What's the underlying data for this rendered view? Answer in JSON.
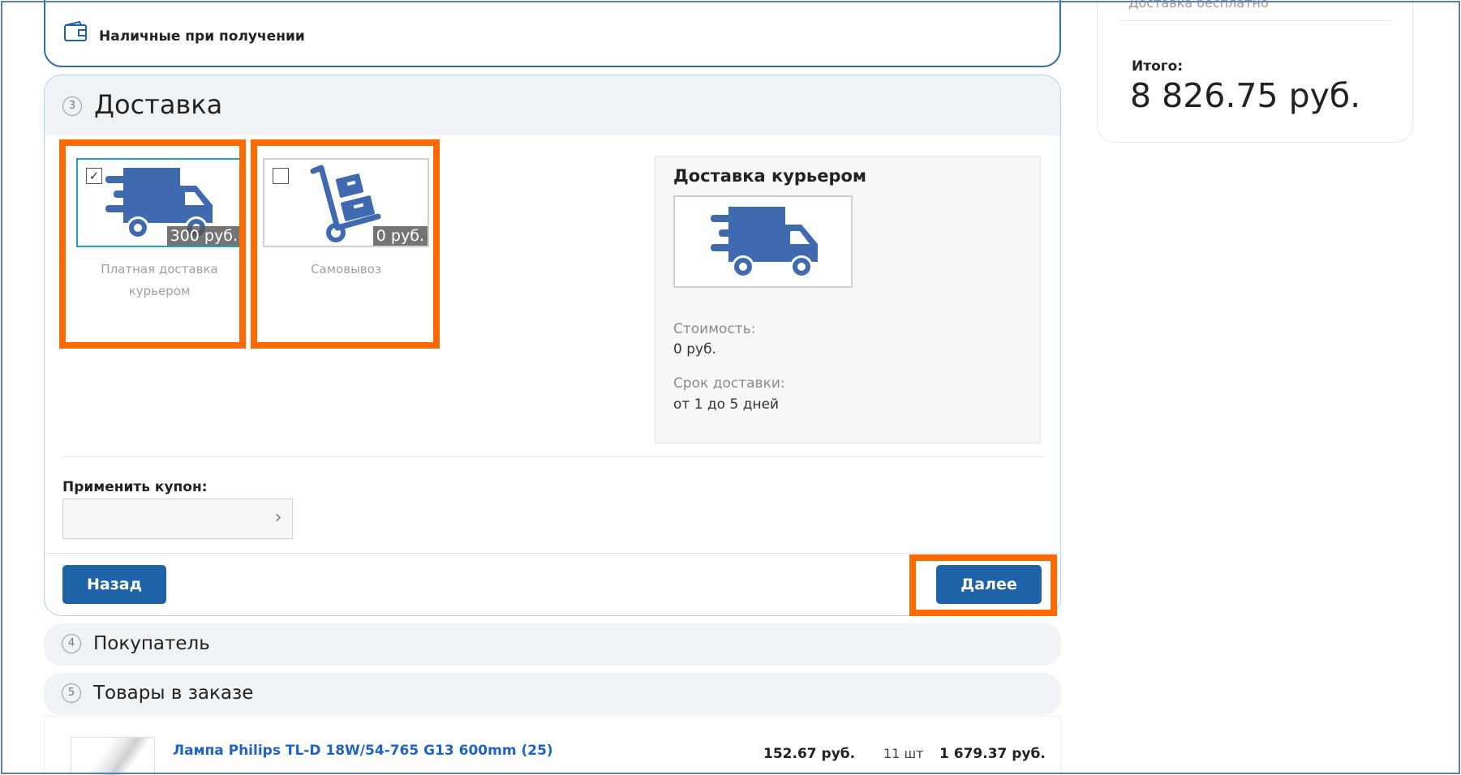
{
  "payment": {
    "selected_label": "Наличные при получении"
  },
  "delivery": {
    "step": "3",
    "title": "Доставка",
    "options": [
      {
        "price": "300 руб.",
        "label": "Платная доставка курьером",
        "checked": true,
        "icon": "delivery-truck-icon"
      },
      {
        "price": "0 руб.",
        "label": "Самовывоз",
        "checked": false,
        "icon": "hand-truck-boxes-icon"
      }
    ],
    "info": {
      "title": "Доставка курьером",
      "cost_label": "Стоимость:",
      "cost_value": "0 руб.",
      "term_label": "Срок доставки:",
      "term_value": "от 1 до 5 дней"
    },
    "coupon_label": "Применить купон:",
    "coupon_value": "",
    "back_label": "Назад",
    "next_label": "Далее"
  },
  "buyer_section": {
    "step": "4",
    "title": "Покупатель"
  },
  "goods_section": {
    "step": "5",
    "title": "Товары в заказе",
    "items": [
      {
        "name": "Лампа Philips TL-D 18W/54-765 G13 600mm (25)",
        "price": "152.67 руб.",
        "qty": "11 шт",
        "total": "1 679.37 руб."
      }
    ]
  },
  "summary": {
    "cut_text": "Доставка бесплатно",
    "total_label": "Итого:",
    "total_value": "8 826.75 руб."
  },
  "colors": {
    "primary_button": "#1e63a8",
    "highlight": "#ff6a00",
    "selected_border": "#1aa3c7",
    "link": "#1e63c8"
  }
}
